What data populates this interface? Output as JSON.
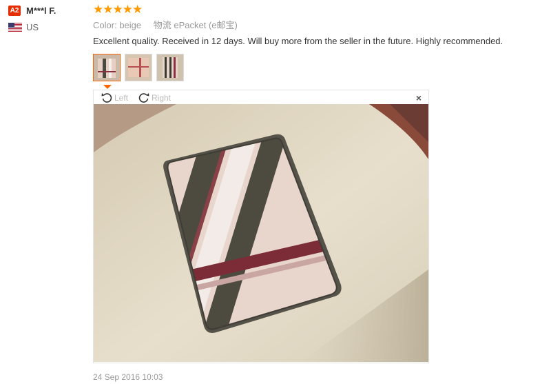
{
  "reviewer": {
    "level_badge": "A2",
    "name": "M***l F.",
    "country": "US",
    "flag_icon": "us-flag-icon"
  },
  "review": {
    "rating": 5,
    "stars": [
      "★",
      "★",
      "★",
      "★",
      "★"
    ],
    "attributes": [
      {
        "label": "Color:",
        "value": "beige"
      },
      {
        "label": "物流",
        "value": "ePacket (e邮宝)"
      }
    ],
    "text": "Excellent quality. Received in 12 days. Will buy more from the seller in the future. Highly recommended.",
    "date": "24 Sep 2016 10:03"
  },
  "viewer": {
    "rotate_left_label": "Left",
    "rotate_right_label": "Right",
    "close_label": "×"
  },
  "colors": {
    "star": "#ff9900",
    "badge": "#e62e04",
    "active_thumb_border": "#ff6600"
  }
}
